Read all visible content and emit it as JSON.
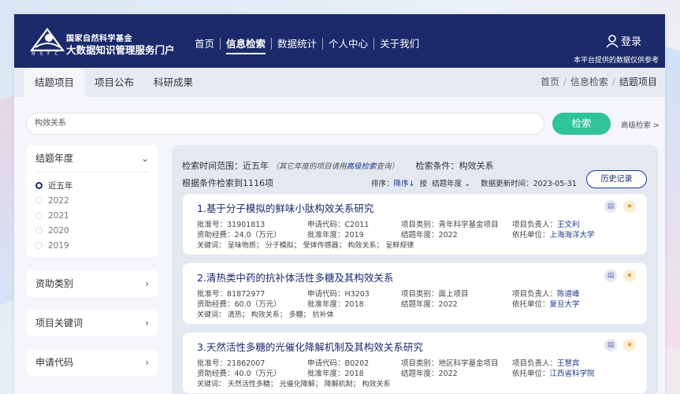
{
  "header": {
    "org_top": "国家自然科学基金",
    "org_main": "大数据知识管理服务门户",
    "logo_abbr": "N S F C",
    "nav": [
      "首页",
      "信息检索",
      "数据统计",
      "个人中心",
      "关于我们"
    ],
    "login": "登录",
    "notice": "本平台提供的数据仅供参考"
  },
  "tabs": [
    "结题项目",
    "项目公布",
    "科研成果"
  ],
  "breadcrumb": [
    "首页",
    "信息检索",
    "结题项目"
  ],
  "search": {
    "value": "构效关系",
    "button": "检索",
    "advanced": "高级检索 >"
  },
  "sidebar": {
    "year": {
      "title": "结题年度",
      "options": [
        "近五年",
        "2022",
        "2021",
        "2020",
        "2019"
      ]
    },
    "funding_type": "资助类别",
    "keywords": "项目关键词",
    "apply_code": "申请代码"
  },
  "results": {
    "range_label": "检索时间范围：近五年",
    "range_note_pre": "（其它年度的项目请用",
    "range_note_link": "高级检索",
    "range_note_post": "查询）",
    "condition": "检索条件：构效关系",
    "count": "根据条件检索到1116项",
    "sort_label": "排序：",
    "sort_order": "降序↓",
    "sort_by_label": "按",
    "sort_field": "结题年度",
    "updated": "数据更新时间：2023-05-31",
    "history": "历史记录",
    "items": [
      {
        "title": "1.基于分子模拟的鲜味小肽构效关系研究",
        "approval": "批准号：31901813",
        "code": "申请代码：C2011",
        "type_label": "项目类别：",
        "type": "青年科学基金项目",
        "leader_label": "项目负责人：",
        "leader": "王文利",
        "funds": "资助经费：24.0（万元）",
        "approve_year": "批准年度：2019",
        "end_year": "结题年度：2022",
        "org_label": "依托单位：",
        "org": "上海海洋大学",
        "keywords": "关键词：   呈味物质；   分子模拟；   受体传感器；   构效关系；   呈鲜规律"
      },
      {
        "title": "2.清热类中药的抗补体活性多糖及其构效关系",
        "approval": "批准号：81872977",
        "code": "申请代码：H3203",
        "type_label": "项目类别：",
        "type": "面上项目",
        "leader_label": "项目负责人：",
        "leader": "陈道峰",
        "funds": "资助经费：60.0（万元）",
        "approve_year": "批准年度：2018",
        "end_year": "结题年度：2022",
        "org_label": "依托单位：",
        "org": "复旦大学",
        "keywords": "关键词：   清热；   构效关系；   多糖；   抗补体"
      },
      {
        "title": "3.天然活性多糖的光催化降解机制及其构效关系研究",
        "approval": "批准号：21862007",
        "code": "申请代码：B0202",
        "type_label": "项目类别：",
        "type": "地区科学基金项目",
        "leader_label": "项目负责人：",
        "leader": "王慧宾",
        "funds": "资助经费：40.0（万元）",
        "approve_year": "批准年度：2018",
        "end_year": "结题年度：2022",
        "org_label": "依托单位：",
        "org": "江西省科学院",
        "keywords": "关键词：   天然活性多糖；   光催化降解；   降解机制；   构效关系"
      }
    ]
  },
  "colors": {
    "header": "#1b2a6b",
    "accent_green": "#2ec497",
    "link_blue": "#1b3a8f"
  },
  "icons": [
    "nsfc-logo-icon",
    "user-icon",
    "chevron-down-icon",
    "chevron-right-icon",
    "document-icon",
    "trophy-icon"
  ]
}
